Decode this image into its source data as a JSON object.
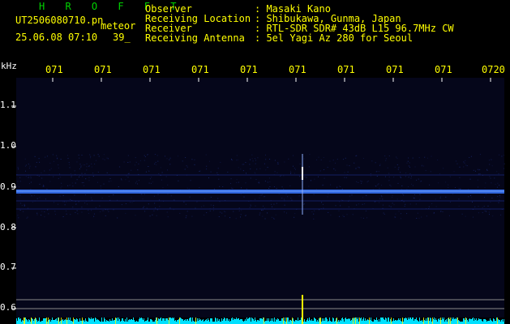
{
  "header": {
    "station": "H R O F F T",
    "filename": "UT2506080710.pn",
    "tag": "meteor",
    "datetime": "25.06.08 07:10",
    "count": "39_"
  },
  "meta": [
    {
      "key": "Observer",
      "value": ": Masaki Kano"
    },
    {
      "key": "Receiving Location",
      "value": ": Shibukawa, Gunma, Japan"
    },
    {
      "key": "Receiver",
      "value": ": RTL-SDR SDR# 43dB L15 96.7MHz CW"
    },
    {
      "key": "Receiving Antenna",
      "value": ": 5el Yagi Az 280 for Seoul"
    }
  ],
  "axis": {
    "unit": "kHz",
    "y_labels": [
      "1.1",
      "1.0",
      "0.9",
      "0.8",
      "0.7",
      "0.6"
    ],
    "x_labels": [
      "071",
      "071",
      "071",
      "071",
      "071",
      "071",
      "071",
      "071",
      "071",
      "0720"
    ]
  },
  "colors": {
    "text_yellow": "#ffff00",
    "station_green": "#00d400",
    "background": "#000000",
    "signal": "#3a78ff",
    "noise_bar": "#00e0ff",
    "meteor": "#ffff00"
  },
  "chart_data": {
    "type": "heatmap",
    "ylabel": "kHz",
    "ylim": [
      0.6,
      1.13
    ],
    "carrier_khz": 0.89,
    "meteor_positions_min": [
      7.16
    ]
  }
}
